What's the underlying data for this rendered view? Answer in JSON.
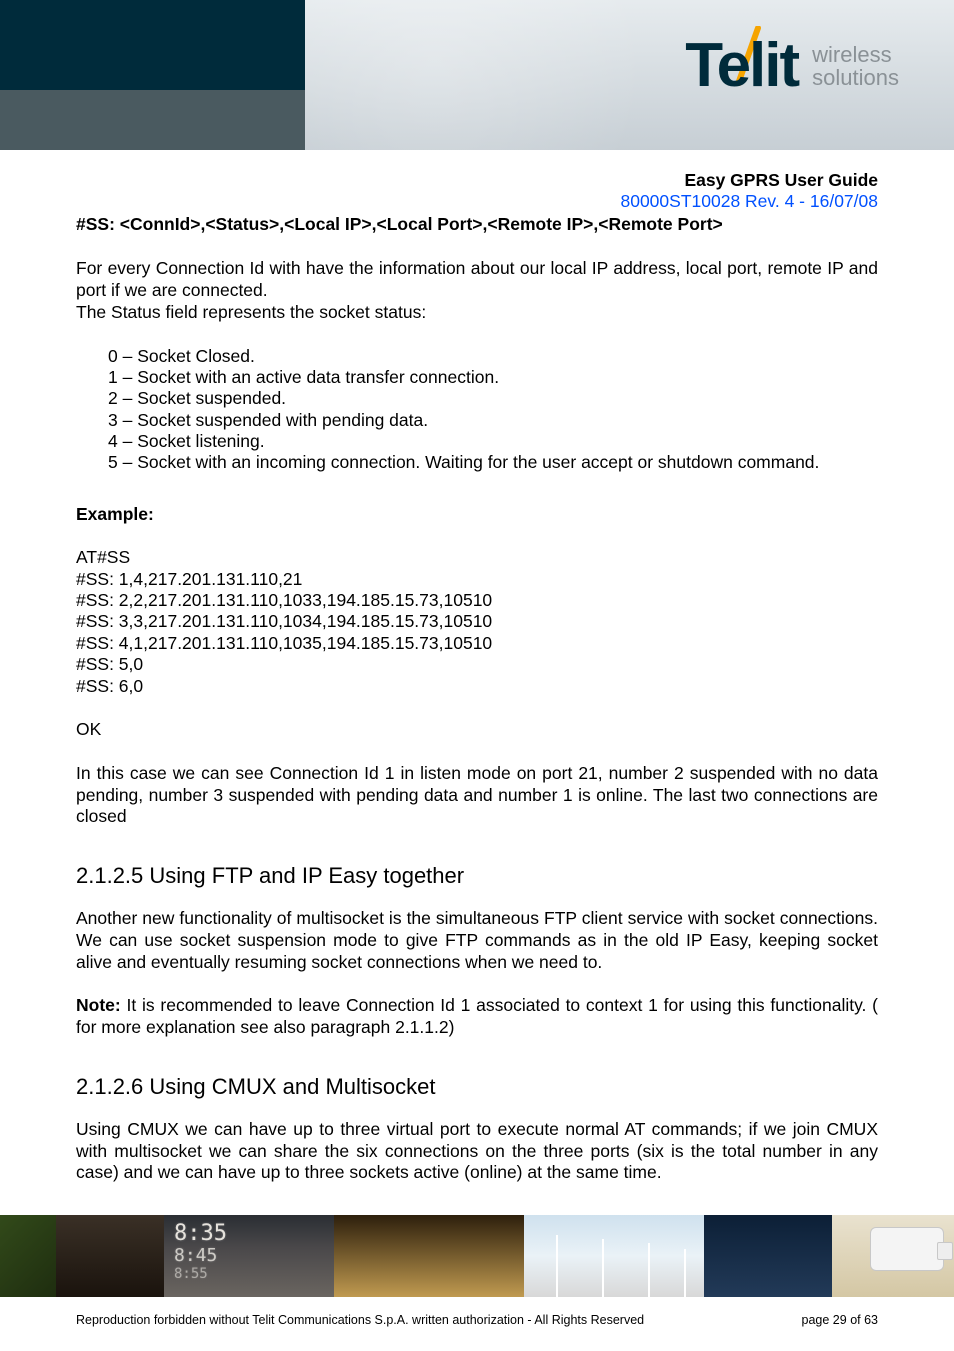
{
  "brand": {
    "name": "Telit",
    "tag1": "wireless",
    "tag2": "solutions",
    "accent": "#f6a400"
  },
  "doc": {
    "title": "Easy GPRS User Guide",
    "revision": "80000ST10028 Rev. 4 - 16/07/08",
    "ss_format": "#SS: <ConnId>,<Status>,<Local IP>,<Local Port>,<Remote IP>,<Remote Port>",
    "intro1": "For every Connection Id with have the information about our local IP address, local port, remote IP and port if we are connected.",
    "intro2": "The Status field represents the socket status:",
    "status_list": [
      "0 – Socket Closed.",
      "1 – Socket with an active data transfer connection.",
      "2 – Socket suspended.",
      "3 – Socket suspended with pending data.",
      "4 – Socket listening.",
      "5 – Socket with an incoming connection. Waiting for the user accept or shutdown command."
    ],
    "example_label": "Example:",
    "example_lines": [
      "AT#SS",
      "#SS: 1,4,217.201.131.110,21",
      "#SS: 2,2,217.201.131.110,1033,194.185.15.73,10510",
      "#SS: 3,3,217.201.131.110,1034,194.185.15.73,10510",
      "#SS: 4,1,217.201.131.110,1035,194.185.15.73,10510",
      "#SS: 5,0",
      "#SS: 6,0"
    ],
    "ok": "OK",
    "after_example": "In this case we can see Connection Id 1 in listen mode on port 21, number 2 suspended with no data pending, number 3 suspended with pending data and number 1 is online. The last two connections are closed",
    "sec1_heading": "2.1.2.5  Using FTP and IP Easy together",
    "sec1_p1": "Another new functionality of multisocket is the simultaneous FTP client service with socket connections. We can use socket suspension mode to give FTP commands as in the old IP Easy, keeping socket alive and eventually resuming socket connections when we need to.",
    "note_label": "Note:",
    "sec1_note_rest": " It is recommended to leave Connection Id 1 associated to context 1 for using this functionality. ( for more explanation see also paragraph 2.1.1.2)",
    "sec2_heading": "2.1.2.6  Using CMUX and Multisocket",
    "sec2_p1": "Using CMUX we can have up to three virtual port to execute normal AT commands; if we join CMUX with multisocket we can share the six connections on the three ports (six is the total number in any case) and we can have up to three sockets active (online) at the same time.",
    "footer_left": "Reproduction forbidden without Telit Communications S.p.A. written authorization - All Rights Reserved",
    "footer_right": "page 29 of 63"
  }
}
